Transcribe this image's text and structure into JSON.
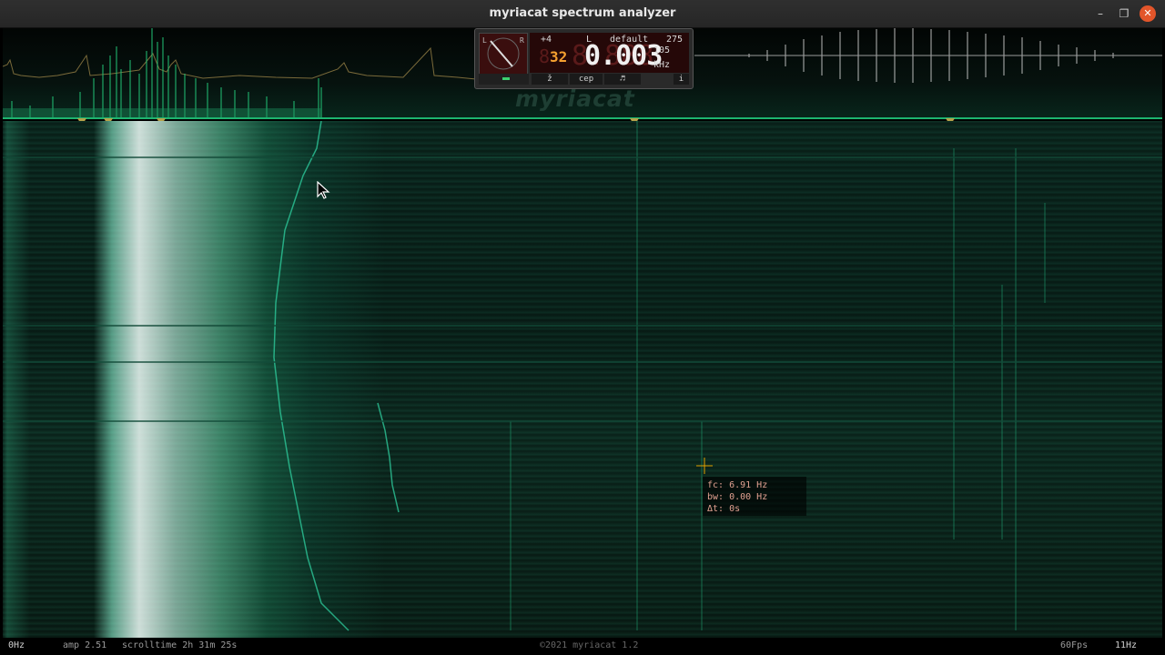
{
  "window": {
    "title": "myriacat spectrum analyzer"
  },
  "window_controls": {
    "minimize": "–",
    "maximize": "❐",
    "close": "✕"
  },
  "meter": {
    "dial_left": "L",
    "dial_right": "R",
    "position": "+4",
    "channel": "L",
    "preset": "default",
    "value_275": "275",
    "ghost_small": "8",
    "small_value": "32",
    "ghost_big": "8.888",
    "big_value": "0.003",
    "sub_value": "105",
    "unit": "kHz",
    "buttons": [
      "ž",
      "cep",
      "♬",
      "i"
    ]
  },
  "logo": "myriacat",
  "cursor_readout": {
    "fc": "fc: 6.91 Hz",
    "bw": "bw: 0.00 Hz",
    "dt": "Δt: 0s"
  },
  "statusbar": {
    "left_freq": "0Hz",
    "amp": "amp 2.51",
    "scrolltime": "scrolltime 2h 31m 25s",
    "copyright": "©2021 myriacat 1.2",
    "fps": "60Fps",
    "right_freq": "11Hz"
  },
  "markers_color": "#b5a24a",
  "accent_color": "#1db46f"
}
